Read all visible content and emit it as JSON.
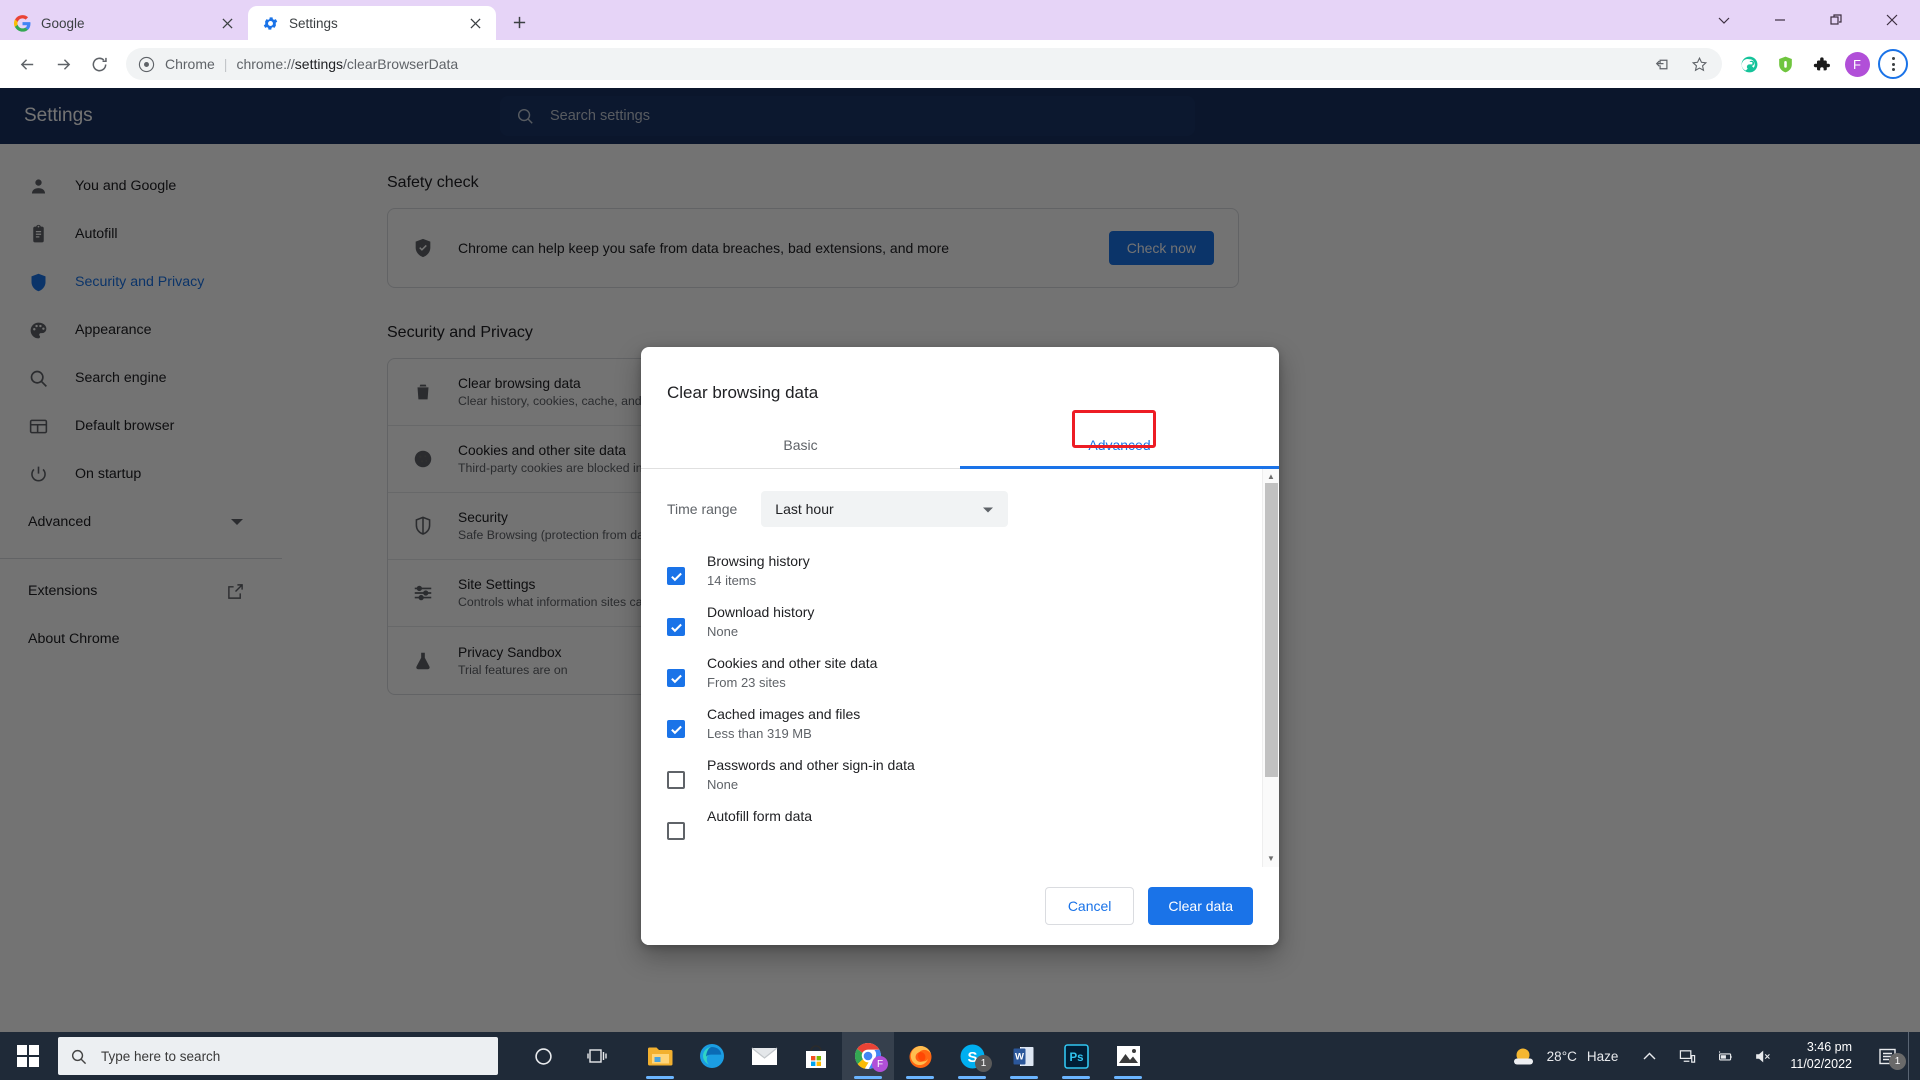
{
  "browser": {
    "tabs": [
      {
        "title": "Google",
        "favicon": "google-icon",
        "active": false
      },
      {
        "title": "Settings",
        "favicon": "gear-icon",
        "active": true
      }
    ],
    "new_tab_label": "+",
    "window_controls": [
      "chevron-down-icon",
      "minimize-icon",
      "restore-icon",
      "close-icon"
    ],
    "omnibox": {
      "site_label": "Chrome",
      "separator": "|",
      "url_prefix": "chrome://",
      "url_bold": "settings",
      "url_suffix": "/clearBrowserData"
    },
    "toolbar_icons": [
      "back-icon",
      "forward-icon",
      "reload-icon"
    ],
    "omnibox_icons": [
      "share-icon",
      "bookmark-star-icon"
    ],
    "extension_icons": [
      "grammarly-icon",
      "pia-vpn-icon",
      "puzzle-extensions-icon"
    ],
    "profile_initial": "F",
    "menu": "three-dots-menu-icon"
  },
  "settings": {
    "header_title": "Settings",
    "search_placeholder": "Search settings",
    "sidebar": [
      {
        "label": "You and Google",
        "icon": "person-icon",
        "selected": false
      },
      {
        "label": "Autofill",
        "icon": "clipboard-icon",
        "selected": false
      },
      {
        "label": "Security and Privacy",
        "icon": "shield-icon",
        "selected": true
      },
      {
        "label": "Appearance",
        "icon": "palette-icon",
        "selected": false
      },
      {
        "label": "Search engine",
        "icon": "search-icon",
        "selected": false
      },
      {
        "label": "Default browser",
        "icon": "browser-window-icon",
        "selected": false
      },
      {
        "label": "On startup",
        "icon": "power-icon",
        "selected": false
      }
    ],
    "sidebar_advanced": {
      "label": "Advanced",
      "icon": "chevron-down-icon"
    },
    "sidebar_links": [
      {
        "label": "Extensions",
        "icon": "external-link-icon"
      },
      {
        "label": "About Chrome",
        "icon": ""
      }
    ],
    "safety_check": {
      "section_title": "Safety check",
      "row_text": "Chrome can help keep you safe from data breaches, bad extensions, and more",
      "icon": "shield-check-icon",
      "button_label": "Check now"
    },
    "privacy_section_title": "Security and Privacy",
    "privacy_rows": [
      {
        "title": "Clear browsing data",
        "sub": "Clear history, cookies, cache, and more",
        "icon": "trash-icon",
        "action": "arrow-right-icon"
      },
      {
        "title": "Cookies and other site data",
        "sub": "Third-party cookies are blocked in Incognito mode",
        "icon": "cookie-icon",
        "action": "arrow-right-icon"
      },
      {
        "title": "Security",
        "sub": "Safe Browsing (protection from dangerous sites) and other security settings",
        "icon": "shield-icon",
        "action": "arrow-right-icon"
      },
      {
        "title": "Site Settings",
        "sub": "Controls what information sites can use and show (location, camera, pop-ups, and more)",
        "icon": "sliders-icon",
        "action": "arrow-right-icon"
      },
      {
        "title": "Privacy Sandbox",
        "sub": "Trial features are on",
        "icon": "flask-icon",
        "action": "external-link-icon"
      }
    ]
  },
  "dialog": {
    "title": "Clear browsing data",
    "tabs": [
      {
        "label": "Basic",
        "active": false
      },
      {
        "label": "Advanced",
        "active": true
      }
    ],
    "highlight_color": "#ed1c24",
    "time_range": {
      "label": "Time range",
      "value": "Last hour",
      "caret": "chevron-down-icon"
    },
    "items": [
      {
        "title": "Browsing history",
        "sub": "14 items",
        "checked": true
      },
      {
        "title": "Download history",
        "sub": "None",
        "checked": true
      },
      {
        "title": "Cookies and other site data",
        "sub": "From 23 sites",
        "checked": true
      },
      {
        "title": "Cached images and files",
        "sub": "Less than 319 MB",
        "checked": true
      },
      {
        "title": "Passwords and other sign-in data",
        "sub": "None",
        "checked": false
      },
      {
        "title": "Autofill form data",
        "sub": "",
        "checked": false
      }
    ],
    "cancel_label": "Cancel",
    "confirm_label": "Clear data",
    "accent_color": "#1a73e8"
  },
  "taskbar": {
    "start_icon": "windows-start-icon",
    "search_placeholder": "Type here to search",
    "search_icon": "search-icon",
    "system_icons": [
      "cortana-circle-icon",
      "task-view-icon"
    ],
    "apps": [
      {
        "name": "file-explorer-icon",
        "running": true,
        "badge": "",
        "active": false
      },
      {
        "name": "microsoft-edge-icon",
        "running": false,
        "badge": "",
        "active": false
      },
      {
        "name": "mail-icon",
        "running": false,
        "badge": "",
        "active": false
      },
      {
        "name": "microsoft-store-icon",
        "running": false,
        "badge": "",
        "active": false
      },
      {
        "name": "google-chrome-icon",
        "running": true,
        "badge": "",
        "active": true
      },
      {
        "name": "firefox-icon",
        "running": true,
        "badge": "",
        "active": false
      },
      {
        "name": "skype-icon",
        "running": true,
        "badge": "1",
        "active": false
      },
      {
        "name": "microsoft-word-icon",
        "running": true,
        "badge": "",
        "active": false
      },
      {
        "name": "photoshop-icon",
        "running": true,
        "badge": "",
        "active": false
      },
      {
        "name": "photos-icon",
        "running": true,
        "badge": "",
        "active": false
      }
    ],
    "weather": {
      "icon": "sun-cloud-icon",
      "temp": "28°C",
      "condition": "Haze"
    },
    "tray_icons": [
      "chevron-up-icon",
      "network-icon",
      "battery-icon",
      "volume-muted-icon"
    ],
    "clock": {
      "time": "3:46 pm",
      "date": "11/02/2022"
    },
    "action_center": {
      "icon": "action-center-icon",
      "badge": "1"
    }
  }
}
